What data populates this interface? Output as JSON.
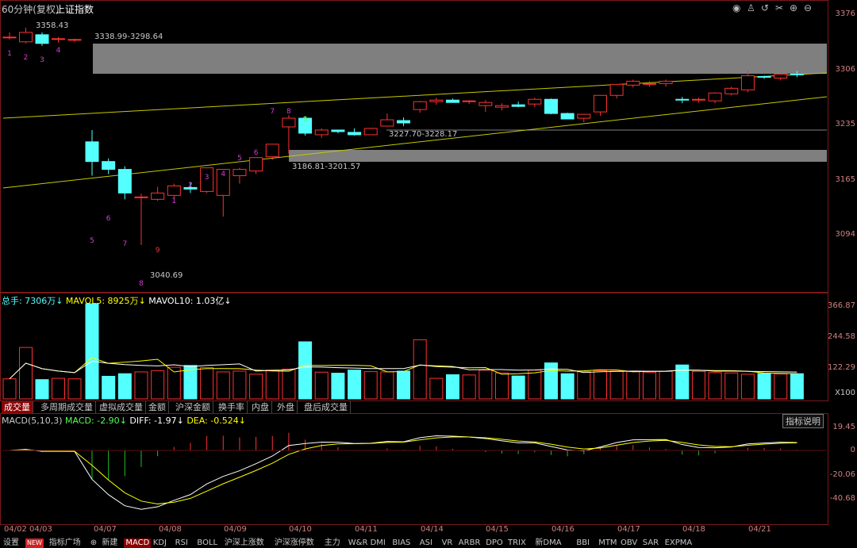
{
  "title": {
    "period": "60分钟(复权)",
    "index": "上证指数"
  },
  "title_icons": [
    "eye-icon",
    "bell-icon",
    "undo-icon",
    "scissors-icon",
    "zoom-in-icon",
    "zoom-out-icon"
  ],
  "price_axis": [
    "3376",
    "3306",
    "3235",
    "3165",
    "3094"
  ],
  "annotations": {
    "high_label": "3358.43",
    "low_label": "3040.69",
    "zone_upper": "3338.99-3298.64",
    "zone_middle": "3227.70-3228.17",
    "zone_lower": "3186.81-3201.57"
  },
  "volume_header": {
    "total": "总手: 7306万",
    "mavol5": "MAVOL5: 8925万",
    "mavol10": "MAVOL10: 1.03亿"
  },
  "volume_axis": [
    "366.87",
    "244.58",
    "122.29",
    "X100"
  ],
  "volume_tabs": [
    "成交量",
    "多周期成交量",
    "虚拟成交量",
    "金额",
    "沪深金额",
    "换手率",
    "内盘",
    "外盘",
    "盘后成交量"
  ],
  "macd_header": {
    "name": "MACD(5,10,3)",
    "macd": "MACD: -2.90",
    "diff": "DIFF: -1.97",
    "dea": "DEA: -0.524"
  },
  "macd_button": "指标说明",
  "macd_axis": [
    "19.45",
    "0",
    "-20.06",
    "-40.68"
  ],
  "dates": [
    "04/02",
    "04/03",
    "04/07",
    "04/08",
    "04/09",
    "04/10",
    "04/11",
    "04/14",
    "04/15",
    "04/16",
    "04/17",
    "04/18",
    "04/21"
  ],
  "bottom_tabs": [
    "设置",
    "NEW",
    "指标广场",
    "⊕",
    "新建",
    "MACD",
    "KDJ",
    "RSI",
    "BOLL",
    "沪深上涨数",
    "沪深涨停数",
    "主力",
    "W&R",
    "DMI",
    "BIAS",
    "ASI",
    "VR",
    "ARBR",
    "DPO",
    "TRIX",
    "新DMA",
    "BBI",
    "MTM",
    "OBV",
    "SAR",
    "EXPMA"
  ],
  "colors": {
    "up": "#ff3030",
    "down": "#54ffff",
    "bg": "#000000",
    "border": "#7a1a1a",
    "diff": "#ffffff",
    "dea": "#ffff00",
    "trend": "#c8c800"
  },
  "candles_digits": [
    "1",
    "2",
    "3",
    "4",
    "5",
    "6",
    "7",
    "8",
    "9",
    "1",
    "2",
    "3",
    "4",
    "5",
    "6",
    "7",
    "8",
    "9"
  ],
  "candles": [
    [
      3345,
      3352,
      3343,
      3346
    ],
    [
      3340,
      3358,
      3338,
      3352
    ],
    [
      3349,
      3352,
      3335,
      3338
    ],
    [
      3344,
      3346,
      3339,
      3344
    ],
    [
      3342,
      3344,
      3340,
      3343
    ],
    [
      3213,
      3228,
      3170,
      3188
    ],
    [
      3188,
      3192,
      3172,
      3178
    ],
    [
      3178,
      3182,
      3140,
      3148
    ],
    [
      3142,
      3147,
      3082,
      3143
    ],
    [
      3140,
      3156,
      3138,
      3148
    ],
    [
      3145,
      3160,
      3140,
      3157
    ],
    [
      3155,
      3162,
      3148,
      3153
    ],
    [
      3150,
      3180,
      3148,
      3180
    ],
    [
      3145,
      3175,
      3118,
      3178
    ],
    [
      3170,
      3180,
      3160,
      3178
    ],
    [
      3176,
      3193,
      3172,
      3193
    ],
    [
      3194,
      3210,
      3190,
      3210
    ],
    [
      3232,
      3247,
      3198,
      3243
    ],
    [
      3243,
      3245,
      3221,
      3224
    ],
    [
      3222,
      3230,
      3218,
      3228
    ],
    [
      3228,
      3228,
      3224,
      3226
    ],
    [
      3225,
      3230,
      3221,
      3222
    ],
    [
      3222,
      3231,
      3222,
      3230
    ],
    [
      3233,
      3249,
      3233,
      3241
    ],
    [
      3240,
      3244,
      3233,
      3237
    ],
    [
      3254,
      3265,
      3250,
      3264
    ],
    [
      3264,
      3269,
      3260,
      3266
    ],
    [
      3266,
      3268,
      3263,
      3263
    ],
    [
      3264,
      3266,
      3261,
      3265
    ],
    [
      3259,
      3266,
      3251,
      3263
    ],
    [
      3257,
      3262,
      3253,
      3259
    ],
    [
      3260,
      3264,
      3257,
      3258
    ],
    [
      3261,
      3269,
      3257,
      3267
    ],
    [
      3267,
      3268,
      3248,
      3249
    ],
    [
      3249,
      3250,
      3243,
      3242
    ],
    [
      3243,
      3248,
      3238,
      3248
    ],
    [
      3251,
      3272,
      3246,
      3272
    ],
    [
      3272,
      3286,
      3268,
      3286
    ],
    [
      3285,
      3292,
      3282,
      3290
    ],
    [
      3287,
      3290,
      3283,
      3287
    ],
    [
      3287,
      3292,
      3283,
      3290
    ],
    [
      3267,
      3270,
      3262,
      3266
    ],
    [
      3266,
      3269,
      3263,
      3267
    ],
    [
      3265,
      3276,
      3262,
      3275
    ],
    [
      3274,
      3283,
      3272,
      3281
    ],
    [
      3279,
      3304,
      3276,
      3297
    ],
    [
      3296,
      3297,
      3293,
      3295
    ],
    [
      3294,
      3300,
      3291,
      3299
    ],
    [
      3299,
      3303,
      3295,
      3298
    ]
  ],
  "volumes": [
    78,
    200,
    75,
    80,
    78,
    370,
    88,
    98,
    105,
    110,
    123,
    130,
    122,
    105,
    108,
    96,
    112,
    116,
    222,
    104,
    100,
    112,
    106,
    105,
    108,
    230,
    80,
    94,
    93,
    112,
    101,
    89,
    112,
    140,
    98,
    106,
    110,
    108,
    106,
    104,
    107,
    132,
    107,
    102,
    101,
    96,
    99,
    97,
    98
  ]
}
